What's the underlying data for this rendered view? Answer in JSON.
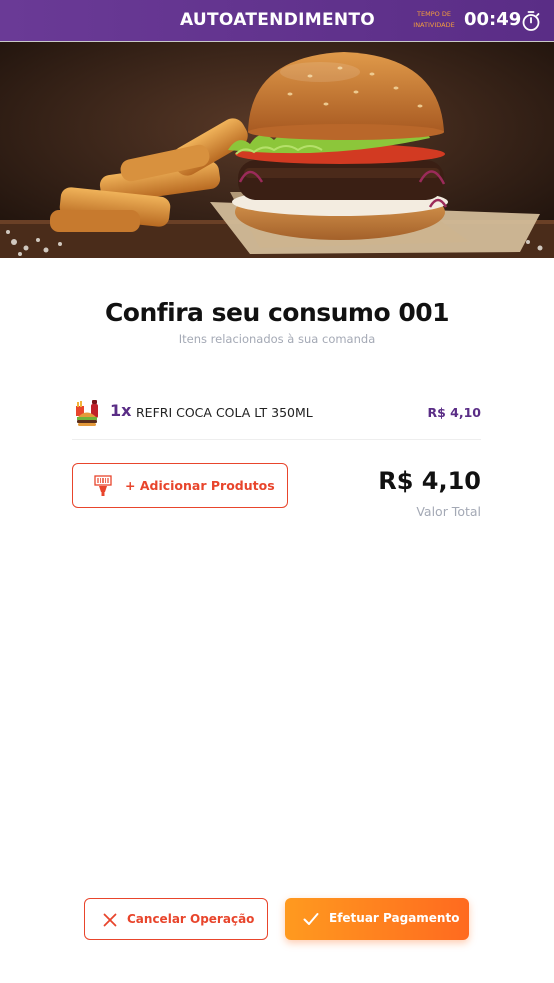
{
  "header": {
    "title": "AUTOATENDIMENTO",
    "timer_label": "TEMPO DE INATIVIDADE",
    "timer_value": "00:49",
    "timer_icon": "stopwatch-icon",
    "bg_color": "#5a2d86",
    "timer_label_color": "#f39c3d"
  },
  "hero": {
    "image": "burger-and-fries-photo"
  },
  "main": {
    "title": "Confira seu consumo 001",
    "subtitle": "Itens relacionados à sua comanda",
    "items": [
      {
        "icon": "combo-food-icon",
        "quantity": "1x",
        "name": "REFRI COCA COLA LT 350ML",
        "price": "R$ 4,10"
      }
    ],
    "add_button": {
      "label": "+ Adicionar Produtos",
      "icon": "barcode-scanner-icon"
    },
    "total": {
      "value": "R$ 4,10",
      "label": "Valor Total"
    }
  },
  "footer": {
    "cancel_label": "Cancelar Operação",
    "cancel_icon": "close-icon",
    "pay_label": "Efetuar Pagamento",
    "pay_icon": "check-icon"
  },
  "colors": {
    "accent": "#e8452c",
    "brand_purple": "#5a2d86",
    "pay_gradient_start": "#ff9a1f",
    "pay_gradient_end": "#ff6a1f"
  }
}
